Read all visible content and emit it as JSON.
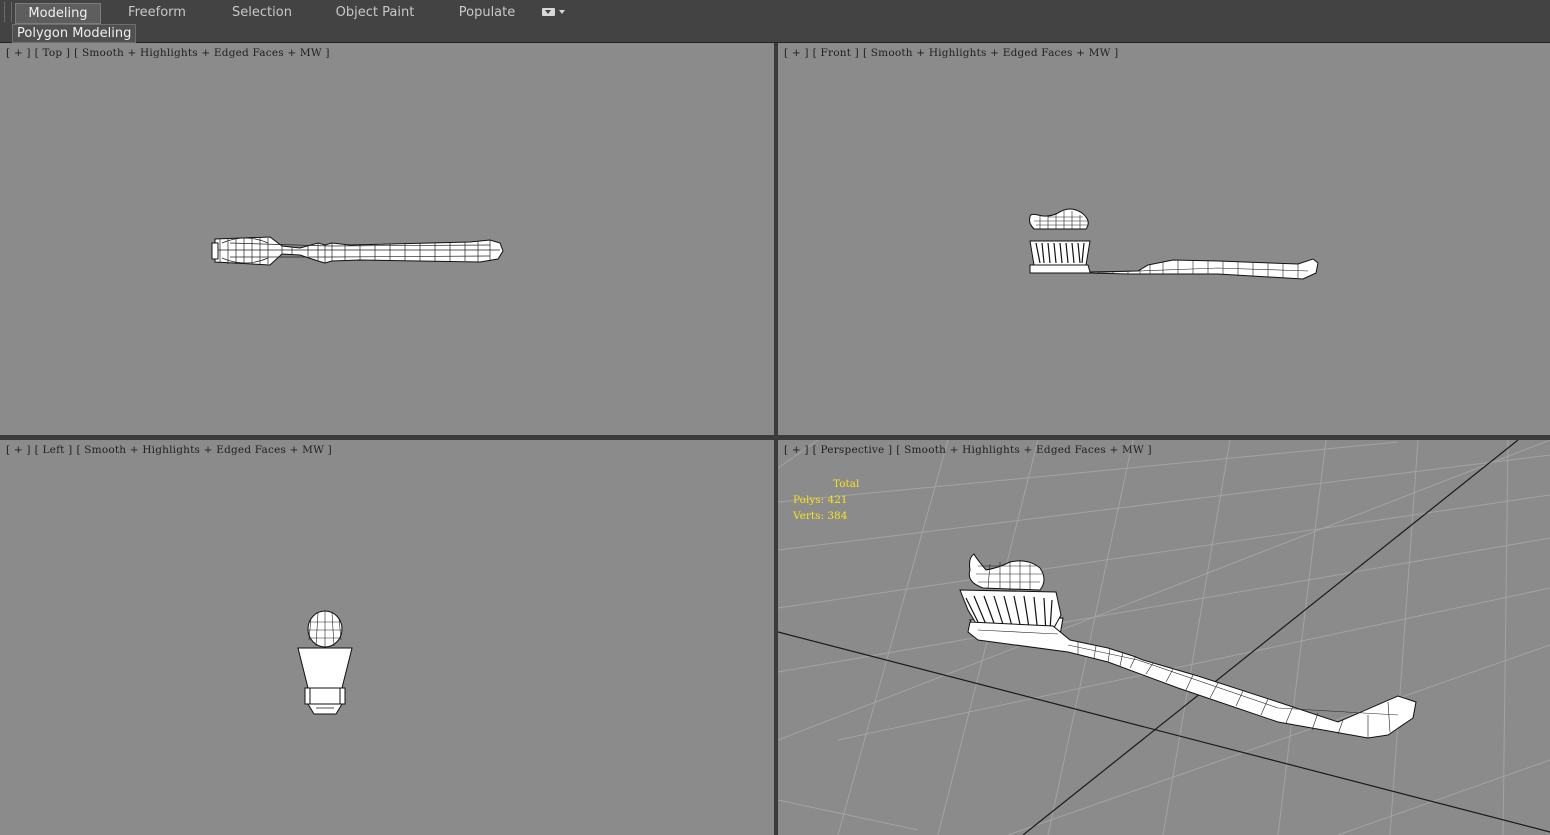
{
  "ribbon": {
    "tabs": [
      {
        "label": "Modeling",
        "active": true
      },
      {
        "label": "Freeform",
        "active": false
      },
      {
        "label": "Selection",
        "active": false
      },
      {
        "label": "Object Paint",
        "active": false
      },
      {
        "label": "Populate",
        "active": false
      }
    ],
    "panel_label": "Polygon Modeling"
  },
  "viewports": {
    "top": {
      "plus": "[ + ]",
      "view": "[ Top ]",
      "shading": "[ Smooth + Highlights + Edged Faces + MW ]"
    },
    "front": {
      "plus": "[ + ]",
      "view": "[ Front ]",
      "shading": "[ Smooth + Highlights + Edged Faces + MW ]"
    },
    "left": {
      "plus": "[ + ]",
      "view": "[ Left ]",
      "shading": "[ Smooth + Highlights + Edged Faces + MW ]"
    },
    "perspective": {
      "plus": "[ + ]",
      "view": "[ Perspective ]",
      "shading": "[ Smooth + Highlights + Edged Faces + MW ]",
      "stats": {
        "total_label": "Total",
        "polys": "Polys: 421",
        "verts": "Verts: 384"
      }
    }
  },
  "colors": {
    "viewport_bg": "#8b8b8b",
    "ui_bg": "#434343",
    "stats_text": "#f7e21b",
    "wire": "#000000",
    "mesh": "#ffffff"
  }
}
